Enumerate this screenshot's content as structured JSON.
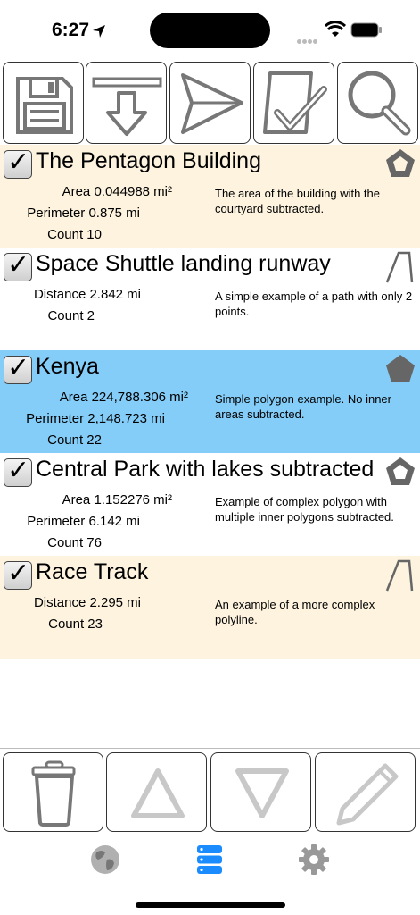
{
  "status_bar": {
    "time": "6:27",
    "icons": [
      "location-arrow-icon",
      "cellular-signal-icon",
      "wifi-icon",
      "battery-icon"
    ]
  },
  "toolbar": {
    "buttons": [
      {
        "name": "save",
        "icon": "floppy-disk-icon"
      },
      {
        "name": "import",
        "icon": "download-arrow-icon"
      },
      {
        "name": "send",
        "icon": "paper-plane-icon"
      },
      {
        "name": "select",
        "icon": "checkbox-icon"
      },
      {
        "name": "search",
        "icon": "magnifier-icon"
      }
    ]
  },
  "items": [
    {
      "title": "The Pentagon Building",
      "checked_glyph": "✓",
      "shape_icon": "polygon-with-hole-icon",
      "area": "Area 0.044988 mi²",
      "perimeter": "Perimeter 0.875 mi",
      "count": "Count 10",
      "description": "The area of the building with the courtyard subtracted."
    },
    {
      "title": "Space Shuttle landing runway",
      "checked_glyph": "✓",
      "shape_icon": "polyline-icon",
      "distance": "Distance 2.842 mi",
      "count": "Count 2",
      "description": "A simple example of a path with only 2 points."
    },
    {
      "title": "Kenya",
      "checked_glyph": "✓",
      "shape_icon": "polygon-icon",
      "area": "Area 224,788.306 mi²",
      "perimeter": "Perimeter 2,148.723 mi",
      "count": "Count 22",
      "description": "Simple polygon example. No inner areas subtracted.",
      "selected": true
    },
    {
      "title": "Central Park with lakes subtracted",
      "checked_glyph": "✓",
      "shape_icon": "polygon-with-hole-icon",
      "area": "Area 1.152276 mi²",
      "perimeter": "Perimeter 6.142 mi",
      "count": "Count 76",
      "description": "Example of complex polygon with multiple inner polygons subtracted."
    },
    {
      "title": "Race Track",
      "checked_glyph": "✓",
      "shape_icon": "polyline-icon",
      "distance": "Distance 2.295 mi",
      "count": "Count 23",
      "description": "An example of a more complex polyline."
    }
  ],
  "actions": [
    {
      "name": "delete",
      "icon": "trash-can-icon",
      "enabled": true
    },
    {
      "name": "move-up",
      "icon": "triangle-up-icon",
      "enabled": false
    },
    {
      "name": "move-down",
      "icon": "triangle-down-icon",
      "enabled": false
    },
    {
      "name": "edit",
      "icon": "pencil-icon",
      "enabled": false
    }
  ],
  "tabs": [
    {
      "name": "map",
      "icon": "globe-icon",
      "active": false
    },
    {
      "name": "list",
      "icon": "list-icon",
      "active": true
    },
    {
      "name": "settings",
      "icon": "gear-icon",
      "active": false
    }
  ],
  "colors": {
    "alt_row": "#fdf3df",
    "selected_row": "#84cdf8",
    "active_tab": "#1a8cff",
    "inactive_tab": "#999999",
    "disabled_icon": "#c8c8c8"
  }
}
